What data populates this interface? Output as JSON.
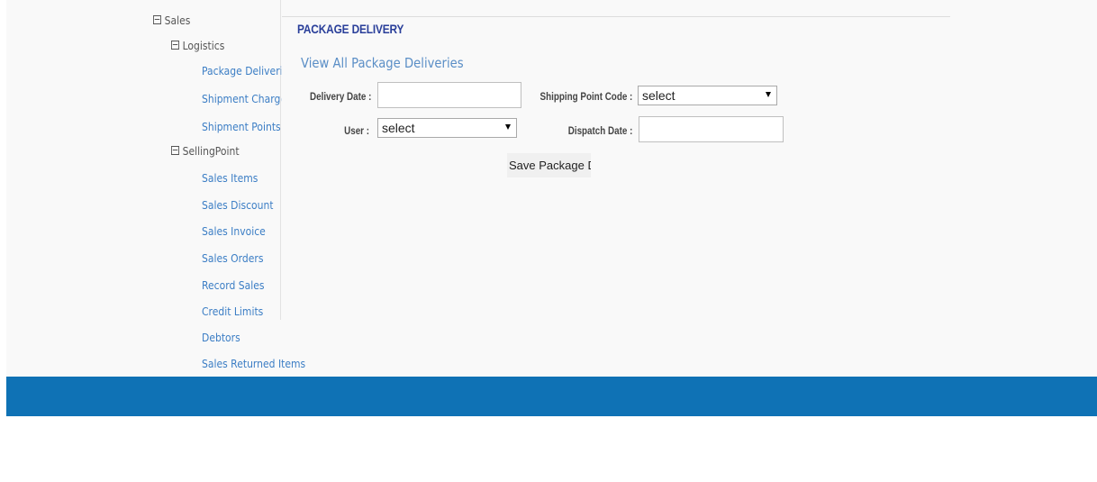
{
  "colors": {
    "top_square_1": "#1a4f7c",
    "top_square_2": "#9a9a9a",
    "top_square_3": "#1a4f7c",
    "footer": "#0f72b5",
    "link": "#3c7ec5",
    "title": "#2a3f9a"
  },
  "sidebar": {
    "sales": "Sales",
    "logistics": "Logistics",
    "logistics_items": [
      "Package Deliveri",
      "Shipment Charge",
      "Shipment Points"
    ],
    "sellingpoint": "SellingPoint",
    "sellingpoint_items": [
      "Sales Items",
      "Sales Discount",
      "Sales Invoice",
      "Sales Orders",
      "Record Sales",
      "Credit Limits",
      "Debtors",
      "Sales Returned Items"
    ]
  },
  "main": {
    "title": "PACKAGE DELIVERY",
    "view_all_link": "View All Package Deliveries",
    "form": {
      "delivery_date_label": "Delivery Date :",
      "delivery_date_value": "",
      "shipping_point_code_label": "Shipping Point Code :",
      "shipping_point_code_value": "select",
      "user_label": "User :",
      "user_value": "select",
      "dispatch_date_label": "Dispatch Date :",
      "dispatch_date_value": ""
    },
    "save_button": "Save Package De"
  }
}
